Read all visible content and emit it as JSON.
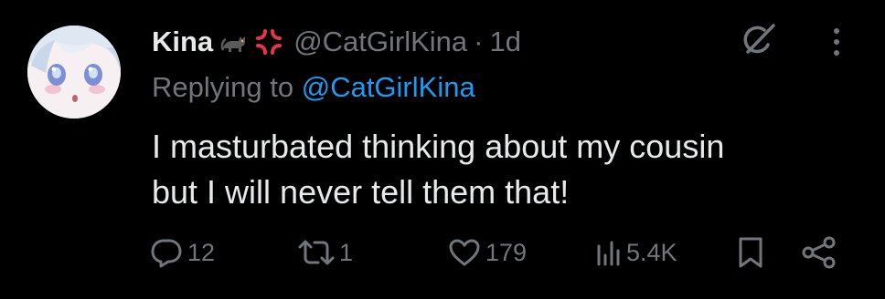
{
  "tweet": {
    "display_name": "Kina",
    "name_emojis": [
      "black-cat-emoji",
      "anger-symbol-emoji"
    ],
    "handle": "@CatGirlKina",
    "separator": "·",
    "timestamp": "1d",
    "replying_prefix": "Replying to",
    "replying_handle": "@CatGirlKina",
    "text_lines": [
      "I masturbated thinking about my cousin",
      "but I will never tell them that!"
    ]
  },
  "actions": {
    "reply_count": "12",
    "retweet_count": "1",
    "like_count": "179",
    "view_count": "5.4K"
  },
  "icons": {
    "grok": "grok-icon",
    "more": "more-vertical-icon",
    "reply": "reply-icon",
    "retweet": "retweet-icon",
    "like": "heart-icon",
    "views": "views-icon",
    "bookmark": "bookmark-icon",
    "share": "share-icon"
  },
  "colors": {
    "background": "#000000",
    "primary_text": "#e7e9ea",
    "secondary_text": "#71767b",
    "link": "#1d9bf0"
  }
}
